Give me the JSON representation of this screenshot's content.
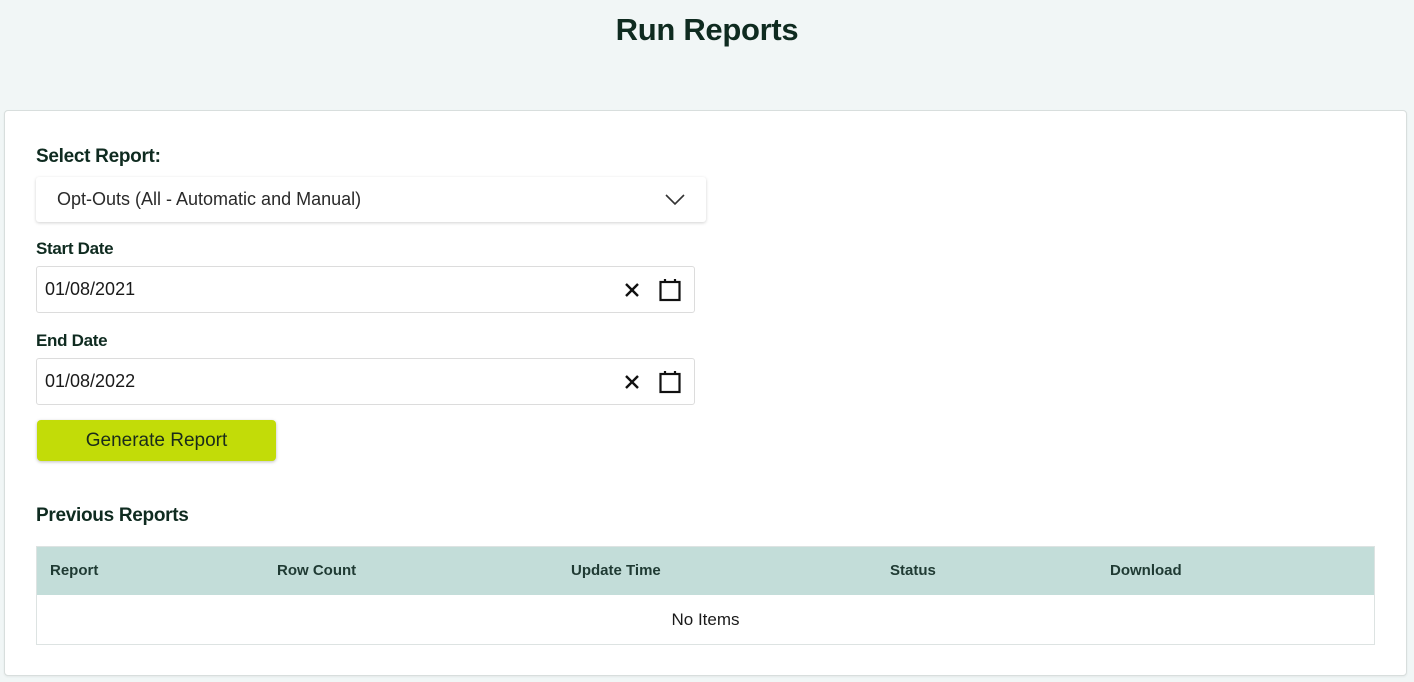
{
  "page": {
    "title": "Run Reports"
  },
  "report_form": {
    "select_label": "Select Report:",
    "selected_report": "Opt-Outs (All - Automatic and Manual)",
    "start_date_label": "Start Date",
    "start_date_value": "01/08/2021",
    "end_date_label": "End Date",
    "end_date_value": "01/08/2022",
    "generate_button_label": "Generate Report",
    "icons": {
      "dropdown": "chevron-down-icon",
      "clear": "close-icon",
      "calendar": "calendar-icon"
    }
  },
  "previous_reports": {
    "title": "Previous Reports",
    "columns": [
      "Report",
      "Row Count",
      "Update Time",
      "Status",
      "Download"
    ],
    "rows": [],
    "empty_text": "No Items"
  },
  "colors": {
    "background": "#f1f6f6",
    "primary_button": "#c2dc08",
    "table_header": "#c3ddd9",
    "heading_text": "#0f2b20"
  }
}
